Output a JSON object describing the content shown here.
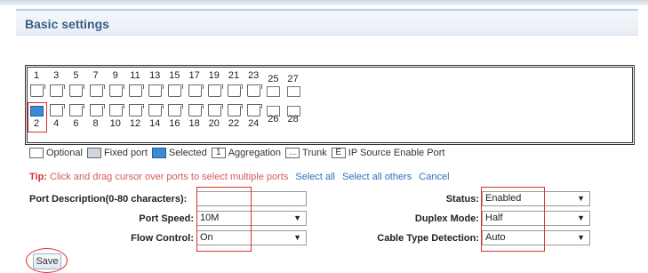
{
  "header": {
    "title": "Basic settings"
  },
  "ports": {
    "top_numbers": [
      "1",
      "3",
      "5",
      "7",
      "9",
      "11",
      "13",
      "15",
      "17",
      "19",
      "21",
      "23",
      "25",
      "27"
    ],
    "bottom_numbers": [
      "2",
      "4",
      "6",
      "8",
      "10",
      "12",
      "14",
      "16",
      "18",
      "20",
      "22",
      "24",
      "26",
      "28"
    ],
    "selected_port": "2"
  },
  "legend": {
    "optional": "Optional",
    "fixed": "Fixed port",
    "selected": "Selected",
    "aggregation": "Aggregation",
    "aggregation_glyph": "1",
    "trunk": "Trunk",
    "trunk_glyph": "...",
    "ipsource": "IP Source Enable Port",
    "ipsource_glyph": "E"
  },
  "tip": {
    "label": "Tip:",
    "text": "Click and drag cursor over ports to select multiple ports",
    "select_all": "Select all",
    "select_others": "Select all others",
    "cancel": "Cancel"
  },
  "form": {
    "port_desc_label": "Port Description(0-80 characters):",
    "port_desc_value": "",
    "port_speed_label": "Port Speed:",
    "port_speed_value": "10M",
    "flow_control_label": "Flow Control:",
    "flow_control_value": "On",
    "status_label": "Status:",
    "status_value": "Enabled",
    "duplex_label": "Duplex Mode:",
    "duplex_value": "Half",
    "cable_label": "Cable Type Detection:",
    "cable_value": "Auto"
  },
  "save_label": "Save",
  "colors": {
    "selected": "#3b8ad4",
    "highlight": "#d9302e",
    "title": "#3a5e86",
    "tip": "#d62f2f"
  }
}
